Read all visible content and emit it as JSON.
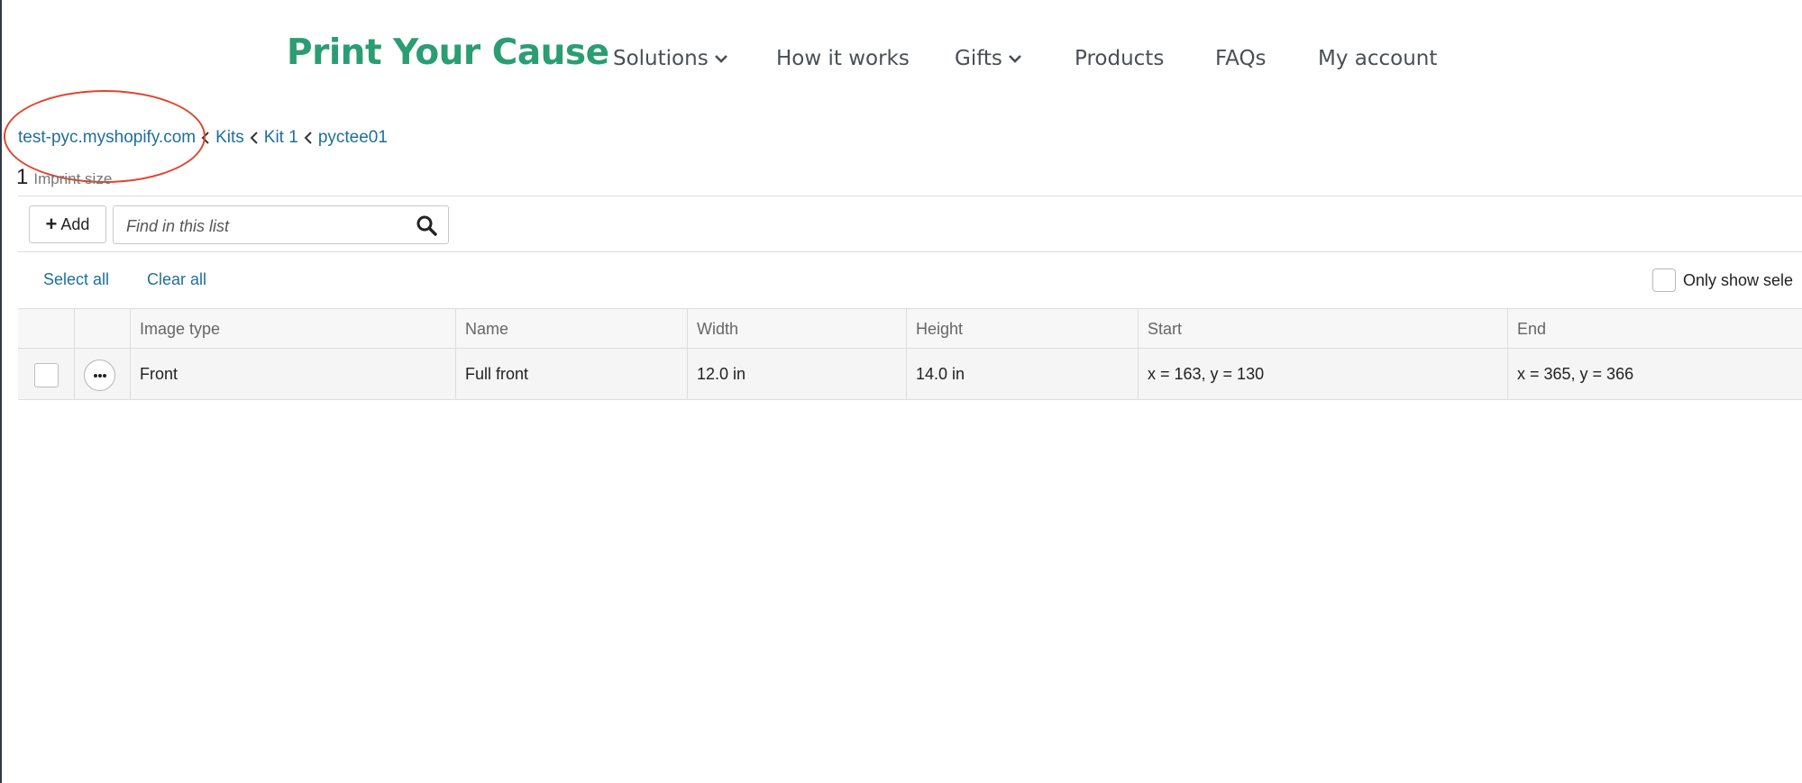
{
  "header": {
    "brand": "Print Your Cause",
    "nav": [
      {
        "label": "Solutions",
        "has_dropdown": true
      },
      {
        "label": "How it works",
        "has_dropdown": false
      },
      {
        "label": "Gifts",
        "has_dropdown": true
      },
      {
        "label": "Products",
        "has_dropdown": false
      },
      {
        "label": "FAQs",
        "has_dropdown": false
      },
      {
        "label": "My account",
        "has_dropdown": false
      }
    ]
  },
  "breadcrumb": [
    "test-pyc.myshopify.com",
    "Kits",
    "Kit 1",
    "pyctee01"
  ],
  "list": {
    "count": "1",
    "count_label": "Imprint size",
    "add_label": "Add",
    "search_placeholder": "Find in this list",
    "select_all": "Select all",
    "clear_all": "Clear all",
    "only_show_selected": "Only show sele"
  },
  "table": {
    "columns": [
      "Image type",
      "Name",
      "Width",
      "Height",
      "Start",
      "End"
    ],
    "rows": [
      [
        "Front",
        "Full front",
        "12.0 in",
        "14.0 in",
        "x = 163, y = 130",
        "x = 365, y = 366"
      ]
    ]
  },
  "colors": {
    "brand": "#2a9d74",
    "link": "#1f6f9a",
    "annotation": "#e0452c"
  },
  "icons": [
    "chevron-down-icon",
    "chevron-left-icon",
    "plus-icon",
    "search-icon",
    "more-icon"
  ]
}
